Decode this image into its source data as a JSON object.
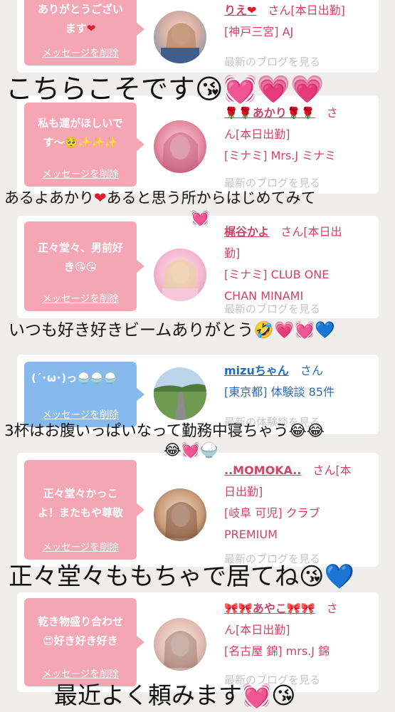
{
  "cards": [
    {
      "message": "ありがとうございます❤",
      "delete_label": "メッセージを削除",
      "name": "りえ❤",
      "name_suffix": "さん[本日出勤]",
      "location": "[神戸三宮] AJ",
      "blog_link": "最新のブログを見る",
      "bubble_color": "pink"
    },
    {
      "message": "私も運が欲しいです〜🥺✨✨✨",
      "delete_label": "メッセージを削除",
      "name": "🌹🌹あかり🌹🌹",
      "name_suffix": "さん[本日出勤]",
      "location": "[ミナミ] Mrs.J ミナミ",
      "blog_link": "最新のブログを見る",
      "bubble_color": "pink"
    },
    {
      "message": "正々堂々、男前好き😘😘",
      "delete_label": "メッセージを削除",
      "name": "梶谷かよ",
      "name_suffix": "さん[本日出勤]",
      "location": "[ミナミ] CLUB ONE CHAN MINAMI",
      "blog_link": "最新のブログを見る",
      "bubble_color": "pink"
    },
    {
      "message": "(´･ω･)っ🍚🍚🍚",
      "delete_label": "メッセージを削除",
      "name": "mizuちゃん",
      "name_suffix": "さん",
      "location": "[東京都] 体験談 85件",
      "blog_link": "最新の体験談を見る",
      "bubble_color": "blue"
    },
    {
      "message": "正々堂々かっこよ！またもや尊敬",
      "delete_label": "メッセージを削除",
      "name": "..MOMOKA..",
      "name_suffix": "さん[本日出勤]",
      "location": "[岐阜 可児] クラブ PREMIUM",
      "blog_link": "最新のブログを見る",
      "bubble_color": "pink"
    },
    {
      "message": "乾き物盛り合わせ😍好き好き好き",
      "delete_label": "メッセージを削除",
      "name": "🎀🎀あやこ🎀🎀",
      "name_suffix": "さん[本日出勤]",
      "location": "[名古屋 錦] mrs.J 錦",
      "blog_link": "最新のブログを見る",
      "bubble_color": "pink"
    }
  ],
  "captions": [
    "こちらこそです😘💓💗💗",
    "あるよあかり❤あると思う所からはじめてみて💓",
    "いつも好き好きビームありがとう🤣💗💓💙",
    "3杯はお腹いっぱいなって勤務中寝ちゃう😂😂😂💓🍚",
    "正々堂々ももちゃで居てね😘💙",
    "最近よく頼みます💓😘"
  ]
}
